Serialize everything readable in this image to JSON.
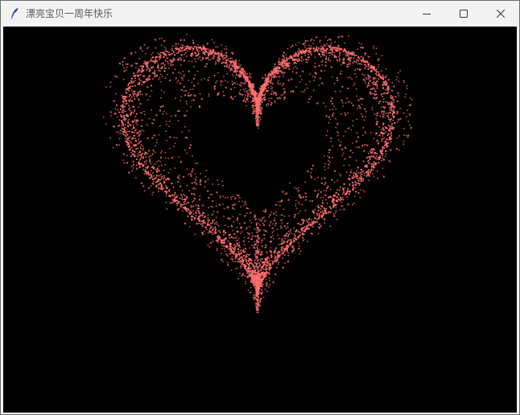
{
  "window": {
    "title": "漂亮宝贝一周年快乐"
  },
  "icons": {
    "app": "feather-icon",
    "minimize": "minimize-icon",
    "maximize": "maximize-icon",
    "close": "close-icon"
  },
  "canvas": {
    "background_color": "#000000",
    "particle_color": "#ff6f6f",
    "shape": "heart"
  }
}
